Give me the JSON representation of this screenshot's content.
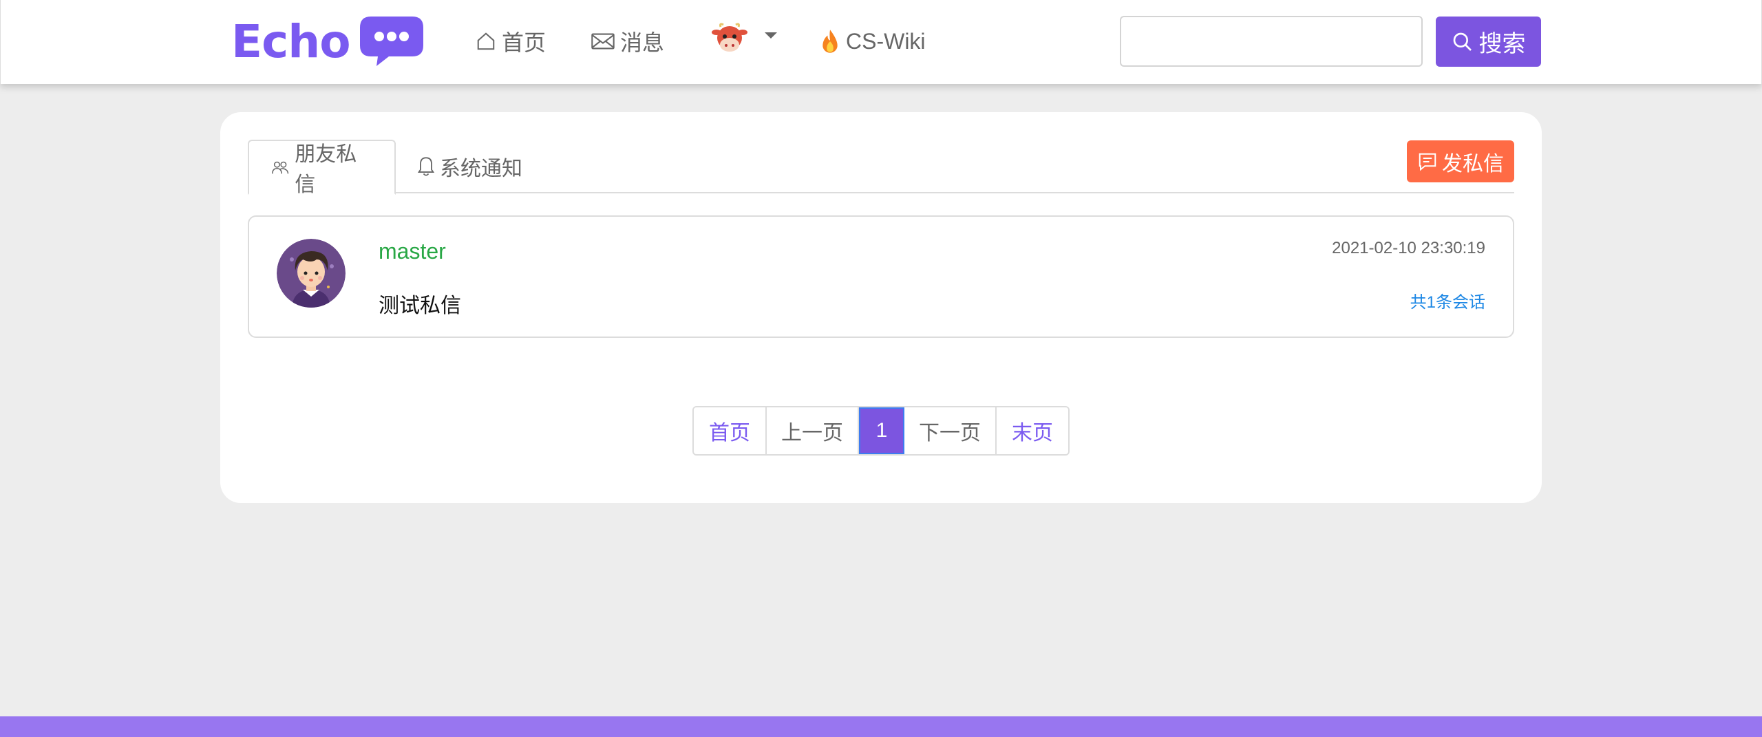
{
  "brand": {
    "name": "Echo",
    "color": "#7a5af0"
  },
  "nav": {
    "home": {
      "label": "首页",
      "icon": "home-icon"
    },
    "messages": {
      "label": "消息",
      "icon": "envelope-icon"
    },
    "user_menu": {
      "icon": "cow-avatar-icon",
      "caret": "caret-down-icon"
    },
    "wiki": {
      "label": "CS-Wiki",
      "icon": "fire-icon"
    }
  },
  "search": {
    "placeholder": "",
    "value": "",
    "button_label": "搜索",
    "button_color": "#7c55e0"
  },
  "tabs": [
    {
      "label": "朋友私信",
      "icon": "users-icon",
      "active": true
    },
    {
      "label": "系统通知",
      "icon": "bell-icon",
      "active": false
    }
  ],
  "send_button": {
    "label": "发私信",
    "icon": "chat-icon",
    "color": "#ff6b45"
  },
  "conversations": [
    {
      "username": "master",
      "content": "测试私信",
      "time": "2021-02-10 23:30:19",
      "count_label": "共1条会话",
      "avatar_icon": "cartoon-boy-avatar"
    }
  ],
  "pagination": {
    "first": "首页",
    "prev": "上一页",
    "current": "1",
    "next": "下一页",
    "last": "末页"
  },
  "colors": {
    "accent": "#7c55e0",
    "footer": "#9876f0",
    "username": "#28a745",
    "link": "#1e88e5"
  }
}
